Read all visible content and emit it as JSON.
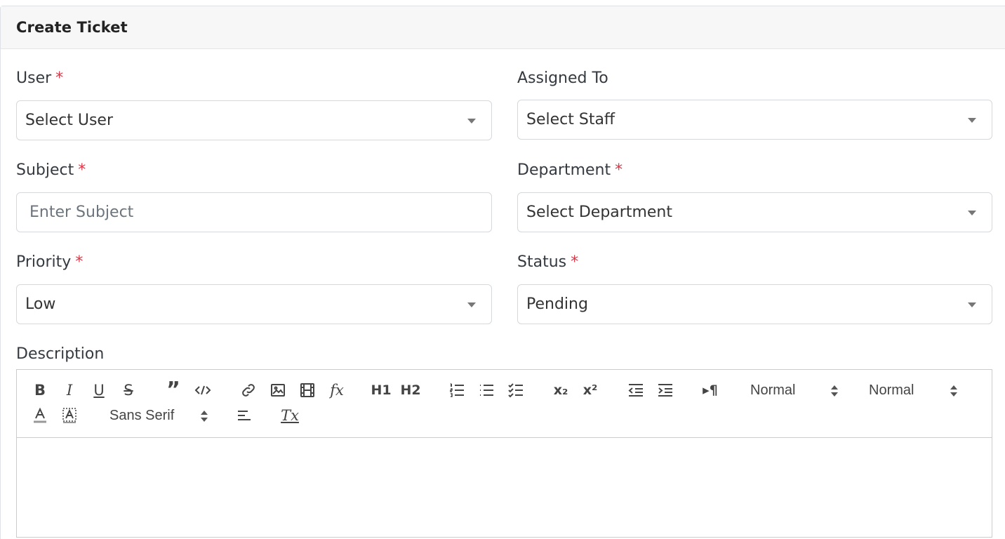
{
  "card": {
    "title": "Create Ticket"
  },
  "fields": {
    "user": {
      "label": "User",
      "required_mark": "*",
      "value": "Select User"
    },
    "assigned_to": {
      "label": "Assigned To",
      "value": "Select Staff"
    },
    "subject": {
      "label": "Subject",
      "required_mark": "*",
      "placeholder": "Enter Subject"
    },
    "department": {
      "label": "Department",
      "required_mark": "*",
      "value": "Select Department"
    },
    "priority": {
      "label": "Priority",
      "required_mark": "*",
      "value": "Low"
    },
    "status": {
      "label": "Status",
      "required_mark": "*",
      "value": "Pending"
    },
    "description": {
      "label": "Description"
    }
  },
  "toolbar": {
    "bold": "B",
    "italic": "I",
    "underline": "U",
    "strike": "S",
    "blockquote": "”",
    "formula": "fx",
    "header1": "H1",
    "header2": "H2",
    "subscript": "x₂",
    "superscript": "x²",
    "direction": "▸¶",
    "size_picker": "Normal",
    "header_picker": "Normal",
    "font_picker": "Sans Serif",
    "clean": "Tx"
  },
  "icons": [
    "bold-icon",
    "italic-icon",
    "underline-icon",
    "strike-icon",
    "blockquote-icon",
    "code-block-icon",
    "link-icon",
    "image-icon",
    "video-icon",
    "formula-icon",
    "ordered-list-icon",
    "bullet-list-icon",
    "check-list-icon",
    "outdent-icon",
    "indent-icon",
    "text-color-icon",
    "background-color-icon",
    "align-icon",
    "clear-format-icon"
  ],
  "colors": {
    "required": "#dc3545",
    "border": "#d5d8dc",
    "header_bg": "#f7f7f8"
  }
}
